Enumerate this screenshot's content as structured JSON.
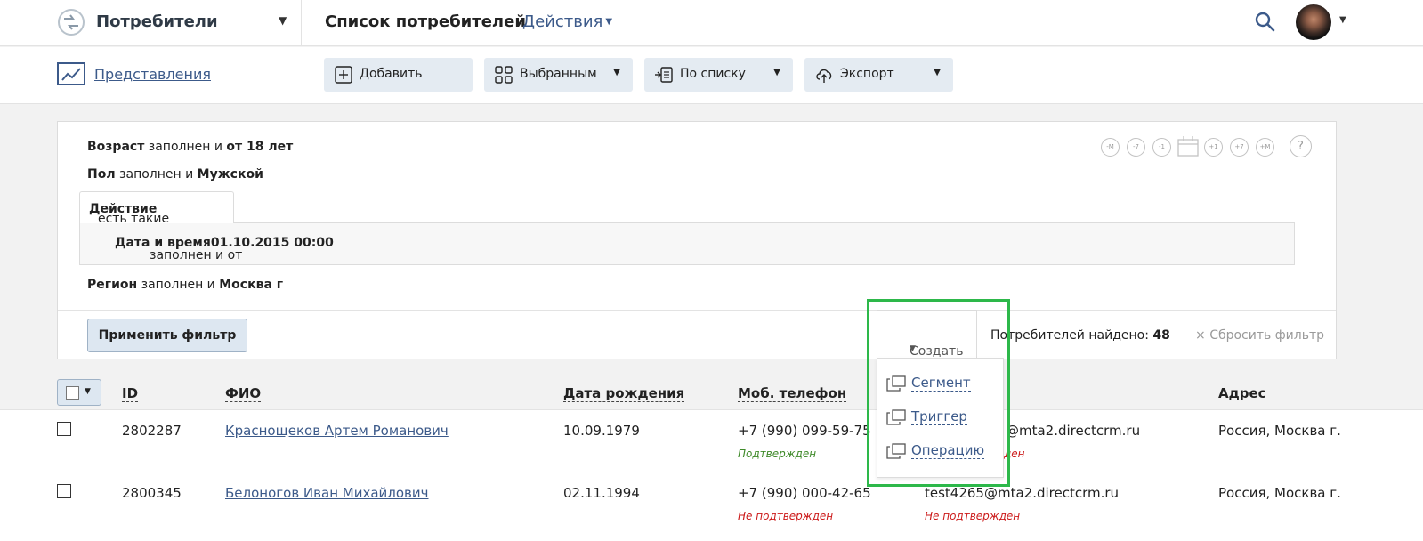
{
  "header": {
    "app_title": "Потребители",
    "page_title": "Список потребителей",
    "actions_label": "Действия"
  },
  "toolbar": {
    "views_label": "Представления",
    "buttons": [
      {
        "label": "Добавить",
        "icon": "plus-box-icon"
      },
      {
        "label": "Выбранным",
        "icon": "grid-icon"
      },
      {
        "label": "По списку",
        "icon": "list-import-icon"
      },
      {
        "label": "Экспорт",
        "icon": "cloud-upload-icon"
      }
    ]
  },
  "filter": {
    "age": {
      "field": "Возраст",
      "cond": " заполнен и ",
      "value": "от 18 лет"
    },
    "gender": {
      "field": "Пол",
      "cond": " заполнен и ",
      "value": "Мужской"
    },
    "action_tab": {
      "field": "Действие",
      "cond": " есть такие"
    },
    "action_date": {
      "field": "Дата и время",
      "cond": " заполнен и от ",
      "value": "01.10.2015 00:00"
    },
    "region": {
      "field": "Регион",
      "cond": " заполнен и ",
      "value": "Москва г"
    },
    "apply_label": "Применить фильтр",
    "found_label": "Потребителей найдено: ",
    "found_count": "48",
    "reset_x": "×",
    "reset_label": "Сбросить фильтр",
    "date_shortcuts": [
      "-M",
      "-7",
      "-1",
      "+1",
      "+7",
      "+M"
    ],
    "help_label": "?"
  },
  "create_menu": {
    "label": "Создать",
    "items": [
      "Сегмент",
      "Триггер",
      "Операцию"
    ]
  },
  "table": {
    "columns": [
      "ID",
      "ФИО",
      "Дата рождения",
      "Моб. телефон",
      "Адрес"
    ],
    "rows": [
      {
        "id": "2802287",
        "name": "Краснощеков Артем Романович",
        "birth": "10.09.1979",
        "phone": "+7 (990) 099-59-75",
        "phone_status": "Подтвержден",
        "email": "@mta2.directcrm.ru",
        "email_status": "ден",
        "address": "Россия, Москва г."
      },
      {
        "id": "2800345",
        "name": "Белоногов Иван Михайлович",
        "birth": "02.11.1994",
        "phone": "+7 (990) 000-42-65",
        "phone_status": "Не подтвержден",
        "email": "test4265@mta2.directcrm.ru",
        "email_status": "Не подтвержден",
        "address": "Россия, Москва г."
      }
    ]
  },
  "colors": {
    "accent": "#3c5a8a",
    "highlight": "#2db84a",
    "confirmed": "#3f8a2a",
    "unconfirmed": "#cc1b1b"
  }
}
